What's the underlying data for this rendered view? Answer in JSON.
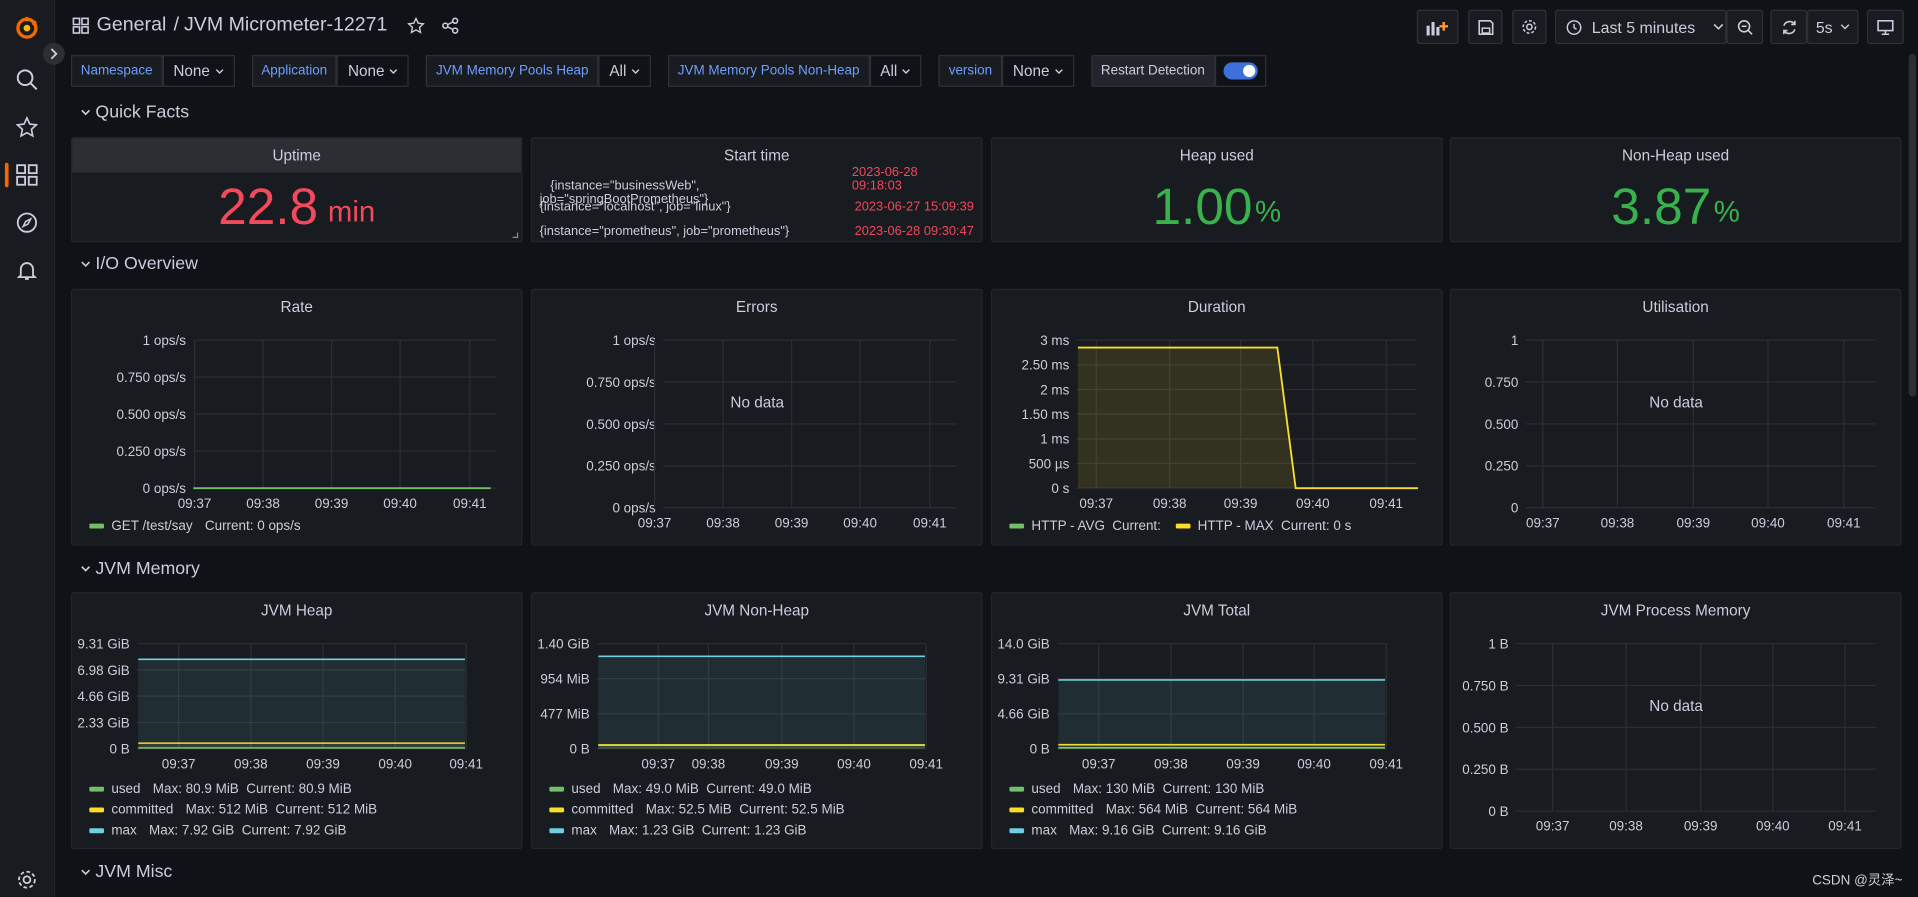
{
  "breadcrumb": {
    "folder": "General",
    "separator": "/",
    "dashboard": "JVM Micrometer-12271"
  },
  "toolbar": {
    "time_range": "Last 5 minutes",
    "refresh_interval": "5s"
  },
  "variables": [
    {
      "label": "Namespace",
      "value": "None"
    },
    {
      "label": "Application",
      "value": "None"
    },
    {
      "label": "JVM Memory Pools Heap",
      "value": "All"
    },
    {
      "label": "JVM Memory Pools Non-Heap",
      "value": "All"
    },
    {
      "label": "version",
      "value": "None"
    }
  ],
  "restart_detection": {
    "label": "Restart Detection",
    "enabled": true
  },
  "rows": {
    "quick_facts": "Quick Facts",
    "io": "I/O Overview",
    "memory": "JVM Memory",
    "misc": "JVM Misc"
  },
  "panels": {
    "uptime": {
      "title": "Uptime",
      "value": "22.8",
      "unit": "min",
      "color": "#f2495c"
    },
    "start_time": {
      "title": "Start time",
      "rows": [
        {
          "labels": "{instance=\"businessWeb\",\njob=\"springBootPrometheus\"}",
          "value": "2023-06-28\n09:18:03"
        },
        {
          "labels": "{instance=\"localhost\", job=\"linux\"}",
          "value": "2023-06-27 15:09:39"
        },
        {
          "labels": "{instance=\"prometheus\", job=\"prometheus\"}",
          "value": "2023-06-28 09:30:47"
        }
      ]
    },
    "heap_used": {
      "title": "Heap used",
      "value": "1.00",
      "unit": "%",
      "color": "#37b24d"
    },
    "nonheap_used": {
      "title": "Non-Heap used",
      "value": "3.87",
      "unit": "%",
      "color": "#37b24d"
    },
    "rate": {
      "title": "Rate",
      "legend": [
        {
          "name": "GET /test/say",
          "stats": "Current: 0 ops/s",
          "color": "#73bf69"
        }
      ]
    },
    "errors": {
      "title": "Errors",
      "nodata": "No data"
    },
    "duration": {
      "title": "Duration",
      "legend": [
        {
          "name": "HTTP - AVG",
          "stats": "Current:",
          "color": "#73bf69"
        },
        {
          "name": "HTTP - MAX",
          "stats": "Current: 0 s",
          "color": "#fade2a"
        }
      ]
    },
    "utilisation": {
      "title": "Utilisation",
      "nodata": "No data"
    },
    "jvm_heap": {
      "title": "JVM Heap",
      "legend": [
        {
          "name": "used",
          "stats": "Max: 80.9 MiB  Current: 80.9 MiB",
          "color": "#73bf69"
        },
        {
          "name": "committed",
          "stats": "Max: 512 MiB  Current: 512 MiB",
          "color": "#fade2a"
        },
        {
          "name": "max",
          "stats": "Max: 7.92 GiB  Current: 7.92 GiB",
          "color": "#6ed0e0"
        }
      ]
    },
    "jvm_nonheap": {
      "title": "JVM Non-Heap",
      "legend": [
        {
          "name": "used",
          "stats": "Max: 49.0 MiB  Current: 49.0 MiB",
          "color": "#73bf69"
        },
        {
          "name": "committed",
          "stats": "Max: 52.5 MiB  Current: 52.5 MiB",
          "color": "#fade2a"
        },
        {
          "name": "max",
          "stats": "Max: 1.23 GiB  Current: 1.23 GiB",
          "color": "#6ed0e0"
        }
      ]
    },
    "jvm_total": {
      "title": "JVM Total",
      "legend": [
        {
          "name": "used",
          "stats": "Max: 130 MiB  Current: 130 MiB",
          "color": "#73bf69"
        },
        {
          "name": "committed",
          "stats": "Max: 564 MiB  Current: 564 MiB",
          "color": "#fade2a"
        },
        {
          "name": "max",
          "stats": "Max: 9.16 GiB  Current: 9.16 GiB",
          "color": "#6ed0e0"
        }
      ]
    },
    "jvm_process": {
      "title": "JVM Process Memory",
      "nodata": "No data"
    }
  },
  "chart_data": [
    {
      "panel": "rate",
      "type": "line",
      "x": [
        "09:37",
        "09:38",
        "09:39",
        "09:40",
        "09:41"
      ],
      "yticks": [
        "1 ops/s",
        "0.750 ops/s",
        "0.500 ops/s",
        "0.250 ops/s",
        "0 ops/s"
      ],
      "ylim": [
        0,
        1
      ],
      "series": [
        {
          "name": "GET /test/say",
          "values": [
            0,
            0,
            0,
            0,
            0
          ],
          "color": "#73bf69"
        }
      ]
    },
    {
      "panel": "errors",
      "type": "line",
      "x": [
        "09:37",
        "09:38",
        "09:39",
        "09:40",
        "09:41"
      ],
      "yticks": [
        "1 ops/s",
        "0.750 ops/s",
        "0.500 ops/s",
        "0.250 ops/s",
        "0 ops/s"
      ],
      "ylim": [
        0,
        1
      ],
      "series": []
    },
    {
      "panel": "duration",
      "type": "area",
      "x": [
        "09:37",
        "09:38",
        "09:39",
        "09:40",
        "09:41"
      ],
      "yticks": [
        "3 ms",
        "2.50 ms",
        "2 ms",
        "1.50 ms",
        "1 ms",
        "500 µs",
        "0 s"
      ],
      "ylim": [
        0,
        3
      ],
      "series": [
        {
          "name": "HTTP - MAX",
          "x": [
            "09:36:50",
            "09:39:35",
            "09:39:50",
            "09:41:25"
          ],
          "values": [
            2.85,
            2.85,
            0,
            0
          ],
          "color": "#fade2a"
        }
      ]
    },
    {
      "panel": "utilisation",
      "type": "line",
      "x": [
        "09:37",
        "09:38",
        "09:39",
        "09:40",
        "09:41"
      ],
      "yticks": [
        "1",
        "0.750",
        "0.500",
        "0.250",
        "0"
      ],
      "ylim": [
        0,
        1
      ],
      "series": []
    },
    {
      "panel": "jvm_heap",
      "type": "area",
      "x": [
        "09:37",
        "09:38",
        "09:39",
        "09:40",
        "09:41"
      ],
      "yticks": [
        "9.31 GiB",
        "6.98 GiB",
        "4.66 GiB",
        "2.33 GiB",
        "0 B"
      ],
      "ylim": [
        0,
        9.31
      ],
      "series": [
        {
          "name": "used",
          "values": [
            0.079,
            0.079,
            0.079,
            0.079,
            0.079
          ]
        },
        {
          "name": "committed",
          "values": [
            0.5,
            0.5,
            0.5,
            0.5,
            0.5
          ]
        },
        {
          "name": "max",
          "values": [
            7.92,
            7.92,
            7.92,
            7.92,
            7.92
          ]
        }
      ]
    },
    {
      "panel": "jvm_nonheap",
      "type": "area",
      "x": [
        "09:37",
        "09:38",
        "09:39",
        "09:40",
        "09:41"
      ],
      "yticks": [
        "1.40 GiB",
        "954 MiB",
        "477 MiB",
        "0 B"
      ],
      "ylim": [
        0,
        1.4
      ],
      "series": [
        {
          "name": "used",
          "values": [
            0.048,
            0.048,
            0.048,
            0.048,
            0.048
          ]
        },
        {
          "name": "committed",
          "values": [
            0.051,
            0.051,
            0.051,
            0.051,
            0.051
          ]
        },
        {
          "name": "max",
          "values": [
            1.23,
            1.23,
            1.23,
            1.23,
            1.23
          ]
        }
      ]
    },
    {
      "panel": "jvm_total",
      "type": "area",
      "x": [
        "09:37",
        "09:38",
        "09:39",
        "09:40",
        "09:41"
      ],
      "yticks": [
        "14.0 GiB",
        "9.31 GiB",
        "4.66 GiB",
        "0 B"
      ],
      "ylim": [
        0,
        14.0
      ],
      "series": [
        {
          "name": "used",
          "values": [
            0.127,
            0.127,
            0.127,
            0.127,
            0.127
          ]
        },
        {
          "name": "committed",
          "values": [
            0.55,
            0.55,
            0.55,
            0.55,
            0.55
          ]
        },
        {
          "name": "max",
          "values": [
            9.16,
            9.16,
            9.16,
            9.16,
            9.16
          ]
        }
      ]
    },
    {
      "panel": "jvm_process",
      "type": "line",
      "x": [
        "09:37",
        "09:38",
        "09:39",
        "09:40",
        "09:41"
      ],
      "yticks": [
        "1 B",
        "0.750 B",
        "0.500 B",
        "0.250 B",
        "0 B"
      ],
      "ylim": [
        0,
        1
      ],
      "series": []
    }
  ],
  "watermark": "CSDN @灵泽~"
}
